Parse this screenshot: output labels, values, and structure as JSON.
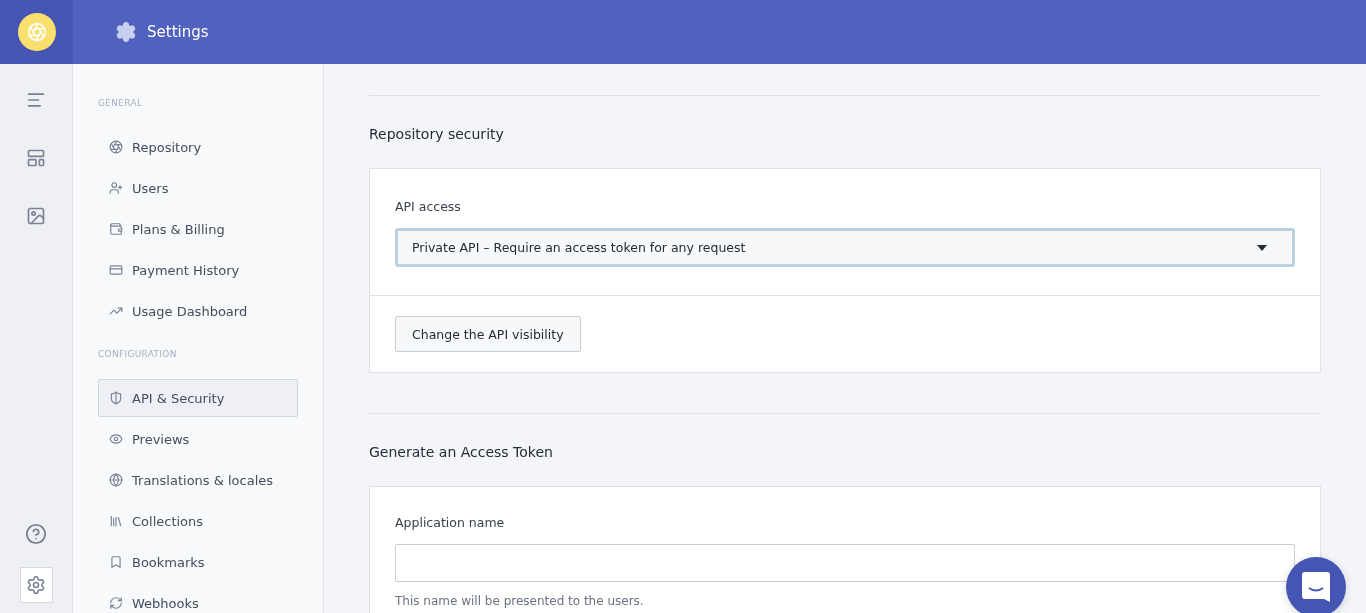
{
  "header": {
    "title": "Settings"
  },
  "settings_nav": {
    "sections": [
      {
        "title": "GENERAL",
        "items": [
          {
            "label": "Repository",
            "selected": false
          },
          {
            "label": "Users",
            "selected": false
          },
          {
            "label": "Plans & Billing",
            "selected": false
          },
          {
            "label": "Payment History",
            "selected": false
          },
          {
            "label": "Usage Dashboard",
            "selected": false
          }
        ]
      },
      {
        "title": "CONFIGURATION",
        "items": [
          {
            "label": "API & Security",
            "selected": true
          },
          {
            "label": "Previews",
            "selected": false
          },
          {
            "label": "Translations & locales",
            "selected": false
          },
          {
            "label": "Collections",
            "selected": false
          },
          {
            "label": "Bookmarks",
            "selected": false
          },
          {
            "label": "Webhooks",
            "selected": false
          }
        ]
      }
    ]
  },
  "repository_security": {
    "title": "Repository security",
    "api_access_label": "API access",
    "api_access_value": "Private API – Require an access token for any request",
    "button": "Change the API visibility"
  },
  "access_token": {
    "title": "Generate an Access Token",
    "app_name_label": "Application name",
    "app_name_hint": "This name will be presented to the users."
  }
}
